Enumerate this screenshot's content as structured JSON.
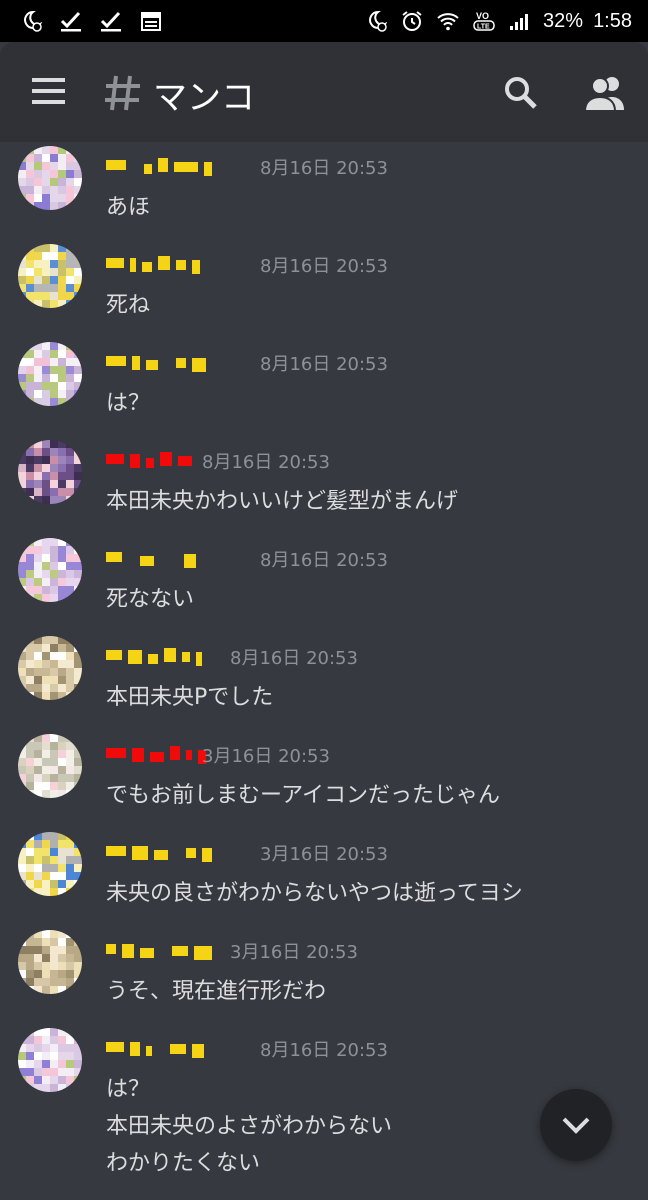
{
  "status_bar": {
    "battery": "32%",
    "time": "1:58",
    "icons_left": [
      "moon-alarm-icon",
      "check-icon",
      "check-icon",
      "calendar-icon"
    ],
    "icons_right": [
      "moon-alarm-icon",
      "alarm-icon",
      "wifi-icon",
      "volte-icon",
      "signal-icon"
    ]
  },
  "header": {
    "channel_name": "マンコ",
    "icons": [
      "menu-icon",
      "hash-icon",
      "search-icon",
      "members-icon"
    ]
  },
  "messages": [
    {
      "username_color": "#f5d415",
      "timestamp": "8月16日 20:53",
      "lines": [
        "あほ"
      ]
    },
    {
      "username_color": "#f5d415",
      "timestamp": "8月16日 20:53",
      "lines": [
        "死ね"
      ]
    },
    {
      "username_color": "#f5d415",
      "timestamp": "8月16日 20:53",
      "lines": [
        "は？"
      ]
    },
    {
      "username_color": "#f00a0a",
      "timestamp": "8月16日 20:53",
      "lines": [
        "本田未央かわいいけど髪型がまんげ"
      ]
    },
    {
      "username_color": "#f5d415",
      "timestamp": "8月16日 20:53",
      "lines": [
        "死なない"
      ]
    },
    {
      "username_color": "#f5d415",
      "timestamp": "8月16日 20:53",
      "lines": [
        "本田未央Pでした"
      ]
    },
    {
      "username_color": "#f00a0a",
      "timestamp": "3月16日 20:53",
      "lines": [
        "でもお前しまむーアイコンだったじゃん"
      ]
    },
    {
      "username_color": "#f5d415",
      "timestamp": "3月16日 20:53",
      "lines": [
        "未央の良さがわからないやつは逝ってヨシ"
      ]
    },
    {
      "username_color": "#f5d415",
      "timestamp": "3月16日 20:53",
      "lines": [
        "うそ、現在進行形だわ"
      ]
    },
    {
      "username_color": "#f5d415",
      "timestamp": "8月16日 20:53",
      "lines": [
        "は？",
        "本田未央のよさがわからない",
        "わかりたくない"
      ]
    }
  ],
  "colors": {
    "background": "#36393f",
    "header": "#2f3136",
    "text": "#dcddde",
    "muted": "#8e9297"
  }
}
